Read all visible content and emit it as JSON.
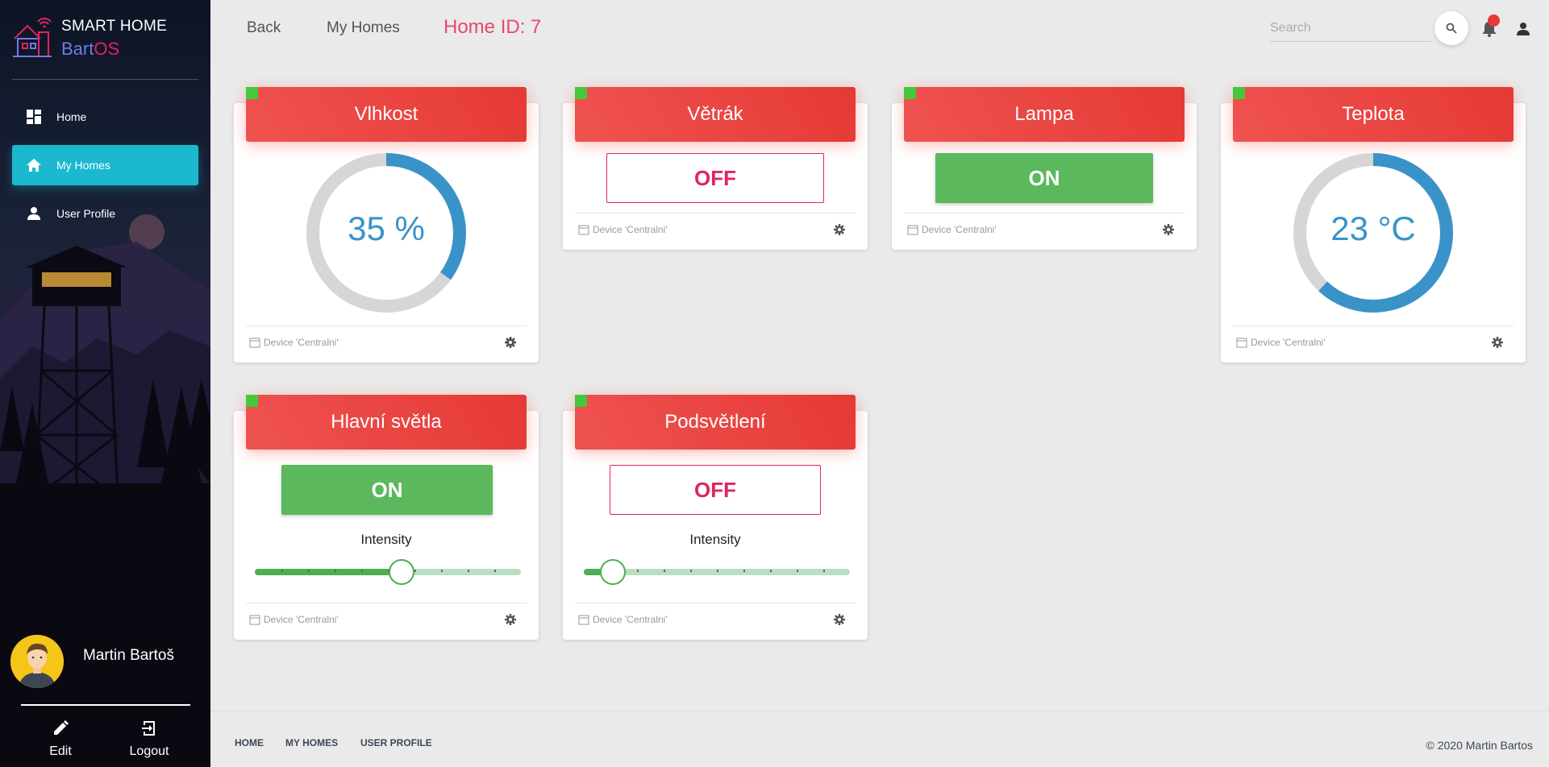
{
  "brand": {
    "top": "SMART HOME",
    "bot_a": "Bart",
    "bot_b": "OS"
  },
  "nav": [
    {
      "label": "Home",
      "icon": "dashboard-icon"
    },
    {
      "label": "My Homes",
      "icon": "home-icon",
      "active": true
    },
    {
      "label": "User Profile",
      "icon": "person-icon"
    }
  ],
  "user": {
    "name": "Martin Bartoš"
  },
  "sidebar_actions": {
    "edit": "Edit",
    "logout": "Logout"
  },
  "topbar": {
    "back": "Back",
    "my_homes": "My Homes",
    "home_id": "Home ID: 7",
    "search_placeholder": "Search"
  },
  "cards": {
    "vlhkost": {
      "title": "Vlhkost",
      "value": "35 %",
      "fraction": 0.35,
      "footer": "Device 'Centralni'"
    },
    "vetrak": {
      "title": "Větrák",
      "state": "OFF",
      "footer": "Device 'Centralni'"
    },
    "lampa": {
      "title": "Lampa",
      "state": "ON",
      "footer": "Device 'Centralni'"
    },
    "teplota": {
      "title": "Teplota",
      "value": "23 °C",
      "fraction": 0.62,
      "footer": "Device 'Centralni'"
    },
    "hlavni": {
      "title": "Hlavní světla",
      "state": "ON",
      "intensity_label": "Intensity",
      "intensity": 0.55,
      "footer": "Device 'Centralni'"
    },
    "podsv": {
      "title": "Podsvětlení",
      "state": "OFF",
      "intensity_label": "Intensity",
      "intensity": 0.11,
      "footer": "Device 'Centralni'"
    }
  },
  "footer": {
    "home": "HOME",
    "my_homes": "MY HOMES",
    "user_profile": "USER PROFILE",
    "copyright": "© 2020 Martin Bartos"
  },
  "colors": {
    "header_red": "#e53935",
    "status_green": "#43c93a",
    "gauge_blue": "#3a93c8",
    "accent_cyan": "#1bb8d0",
    "off_pink": "#e0245e",
    "on_green": "#5cb85c"
  }
}
